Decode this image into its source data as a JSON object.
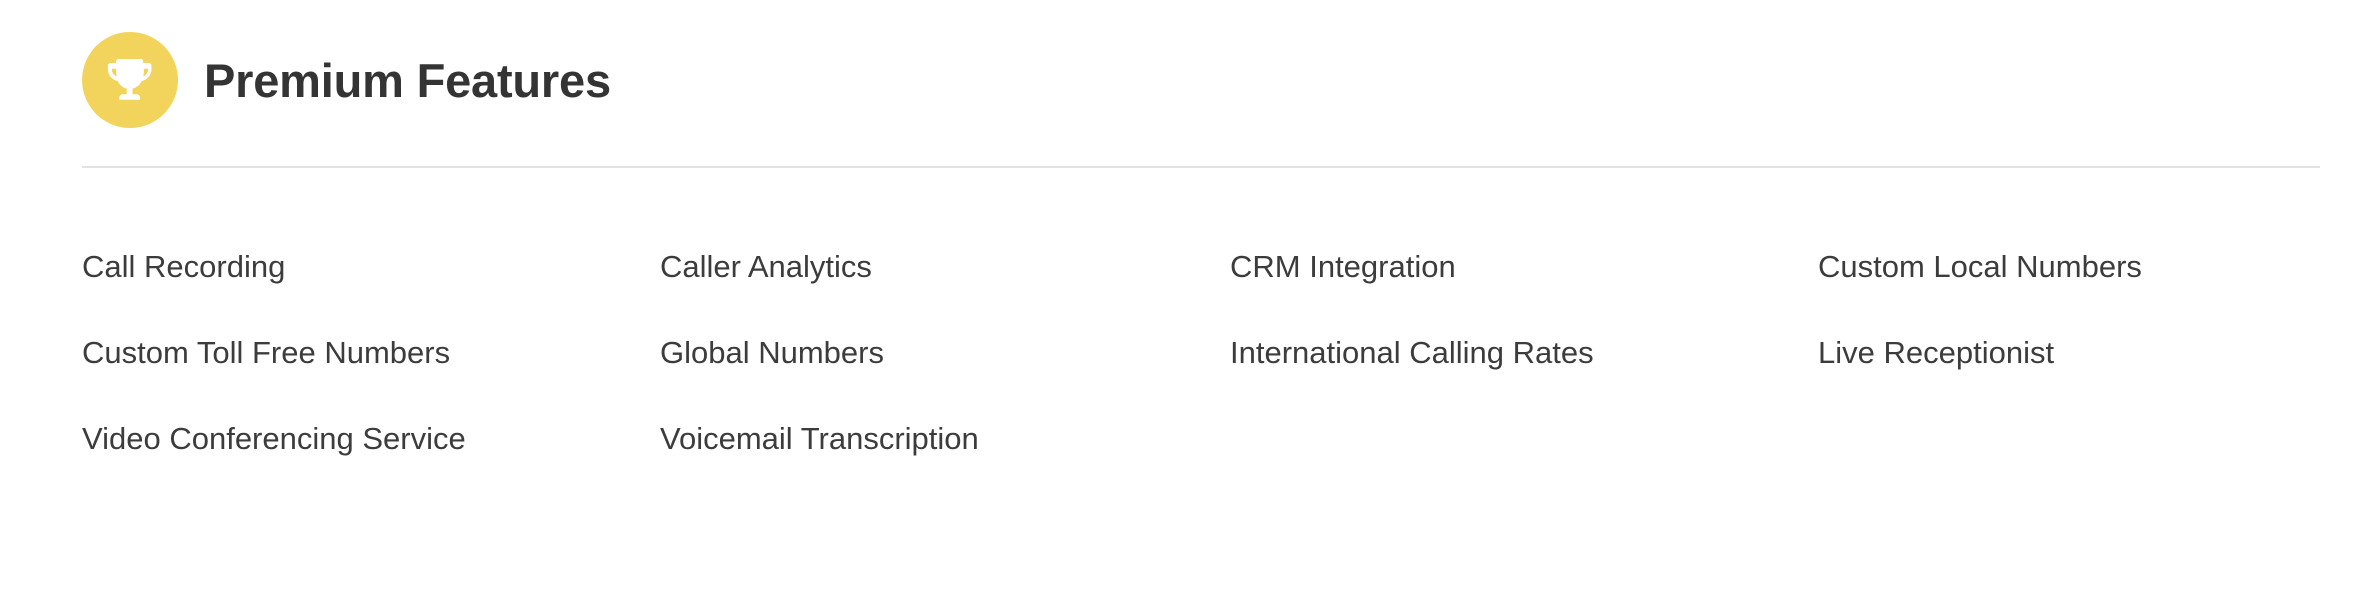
{
  "header": {
    "title": "Premium Features",
    "icon": "trophy-icon",
    "badge_color": "#F2D45C",
    "title_color": "#343434"
  },
  "divider": {
    "color": "#E2E2E2"
  },
  "features": {
    "text_color": "#3C3C3C",
    "columns": 4,
    "rows": 3,
    "items": [
      "Call Recording",
      "Caller Analytics",
      "CRM Integration",
      "Custom Local Numbers",
      "Custom Toll Free Numbers",
      "Global Numbers",
      "International Calling Rates",
      "Live Receptionist",
      "Video Conferencing Service",
      "Voicemail Transcription",
      "",
      ""
    ]
  }
}
